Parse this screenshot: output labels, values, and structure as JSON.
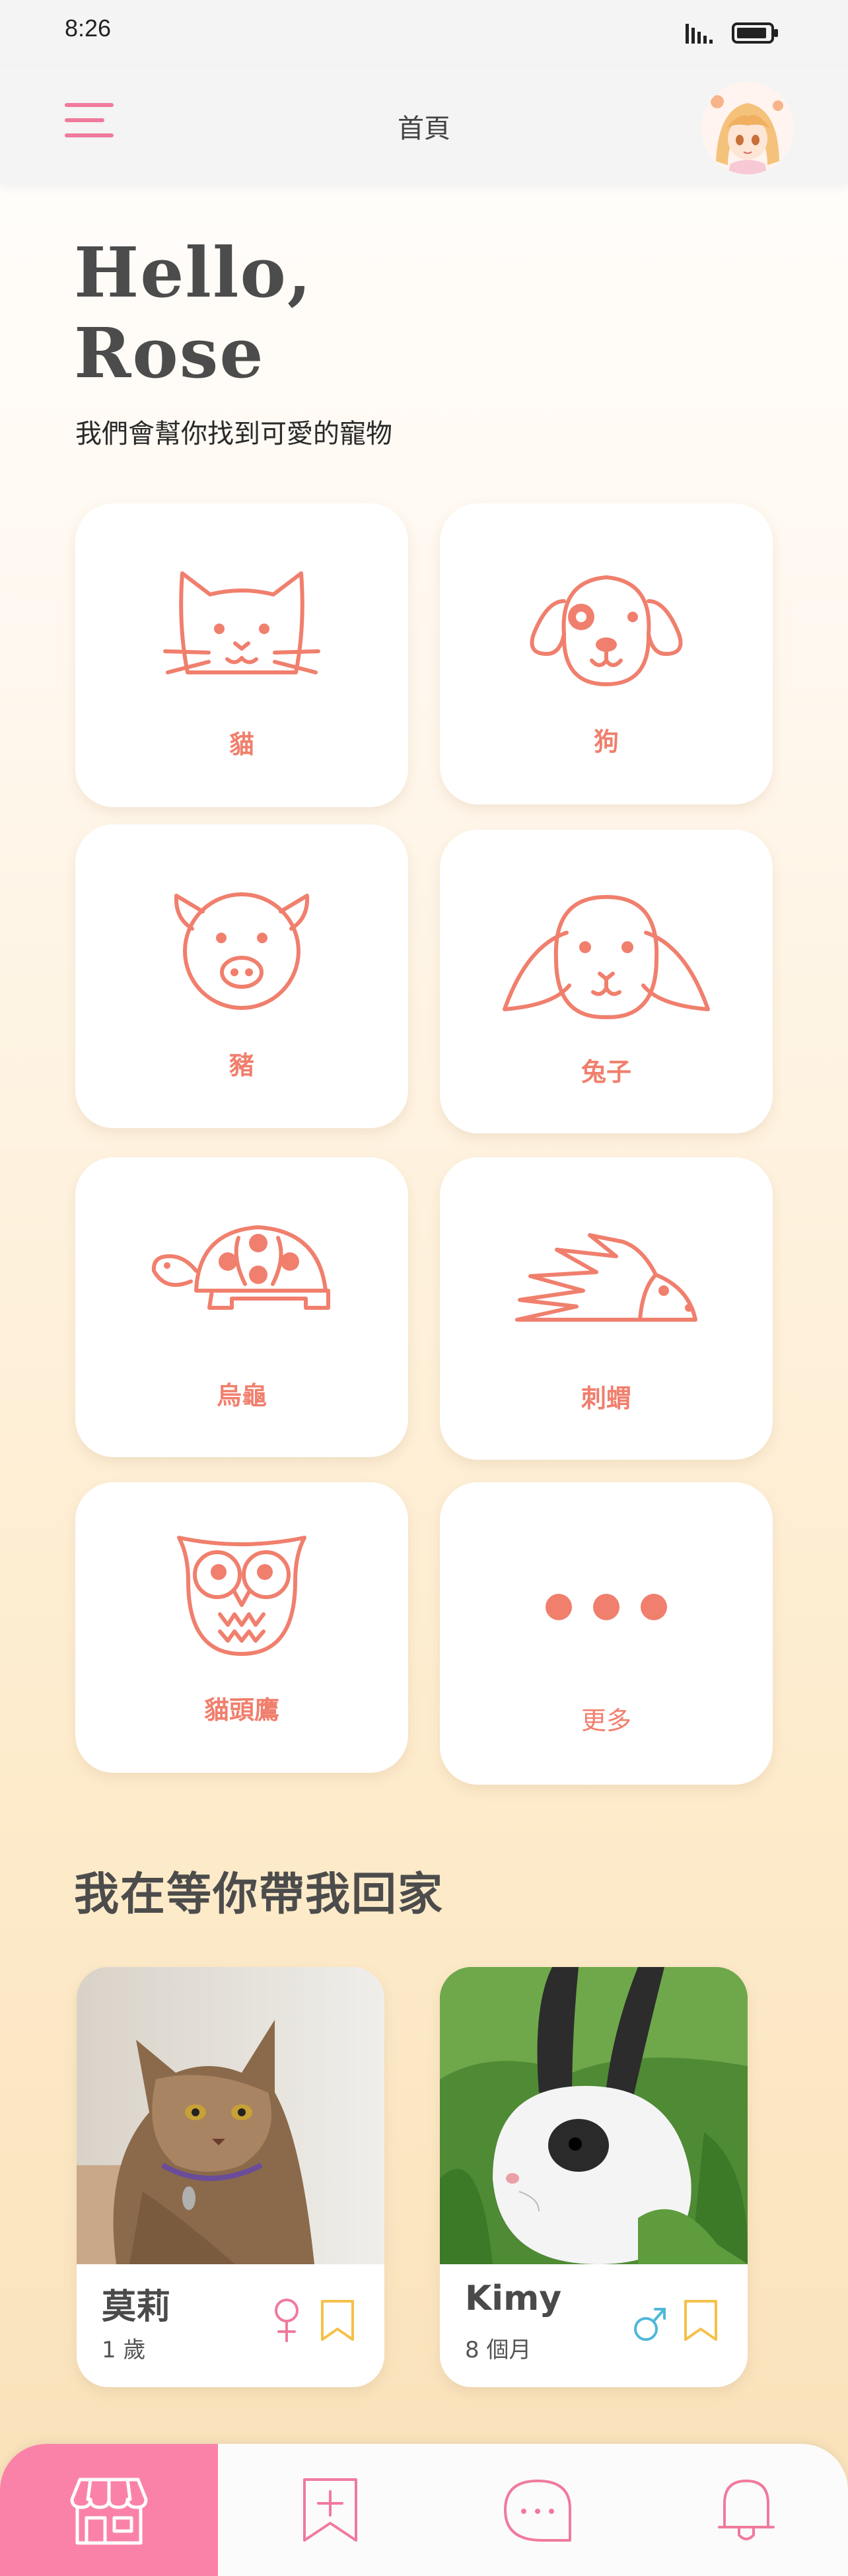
{
  "status": {
    "time": "8:26"
  },
  "header": {
    "title": "首頁"
  },
  "greeting": {
    "line1": "Hello,",
    "line2": "Rose",
    "subtitle": "我們會幫你找到可愛的寵物"
  },
  "categories": [
    {
      "label": "貓",
      "icon": "cat-icon"
    },
    {
      "label": "狗",
      "icon": "dog-icon"
    },
    {
      "label": "豬",
      "icon": "pig-icon"
    },
    {
      "label": "兔子",
      "icon": "rabbit-icon"
    },
    {
      "label": "烏龜",
      "icon": "turtle-icon"
    },
    {
      "label": "刺蝟",
      "icon": "hedgehog-icon"
    },
    {
      "label": "貓頭鷹",
      "icon": "owl-icon"
    },
    {
      "label": "更多",
      "icon": "more-icon"
    }
  ],
  "section": {
    "title": "我在等你帶我回家"
  },
  "pets": [
    {
      "name": "莫莉",
      "age": "1 歲",
      "gender": "female",
      "gender_icon": "female-icon"
    },
    {
      "name": "Kimy",
      "age": "8 個月",
      "gender": "male",
      "gender_icon": "male-icon"
    }
  ],
  "tabs": [
    {
      "icon": "store-icon",
      "active": true
    },
    {
      "icon": "bookmark-add-icon",
      "active": false
    },
    {
      "icon": "chat-icon",
      "active": false
    },
    {
      "icon": "bell-icon",
      "active": false
    }
  ],
  "colors": {
    "accent_pink": "#fa82a8",
    "icon_coral": "#f07f6d",
    "female": "#f07a9d",
    "male": "#4fb7d8",
    "bookmark": "#f5c04a"
  }
}
